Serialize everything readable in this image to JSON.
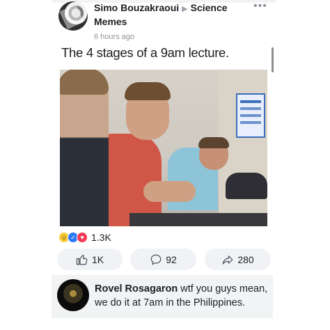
{
  "post": {
    "author": "Simo Bouzakraoui",
    "group": "Science Memes",
    "time": "6 hours ago",
    "text": "The 4 stages of a 9am lecture.",
    "more_icon": "ellipsis-icon"
  },
  "reactions": {
    "icons": [
      "haha-icon",
      "like-icon",
      "love-icon"
    ],
    "count": "1.3K"
  },
  "actions": {
    "like_count": "1K",
    "comment_count": "92",
    "share_count": "280"
  },
  "comment": {
    "author": "Rovel Rosagaron",
    "text": "wtf you guys mean, we do it at 7am in the Philippines."
  },
  "colors": {
    "button_bg": "#f0f2f5",
    "comment_bg": "#f2f3f5",
    "meta_gray": "#90949c",
    "like_blue": "#2c78f6",
    "love_red": "#f23b56"
  }
}
